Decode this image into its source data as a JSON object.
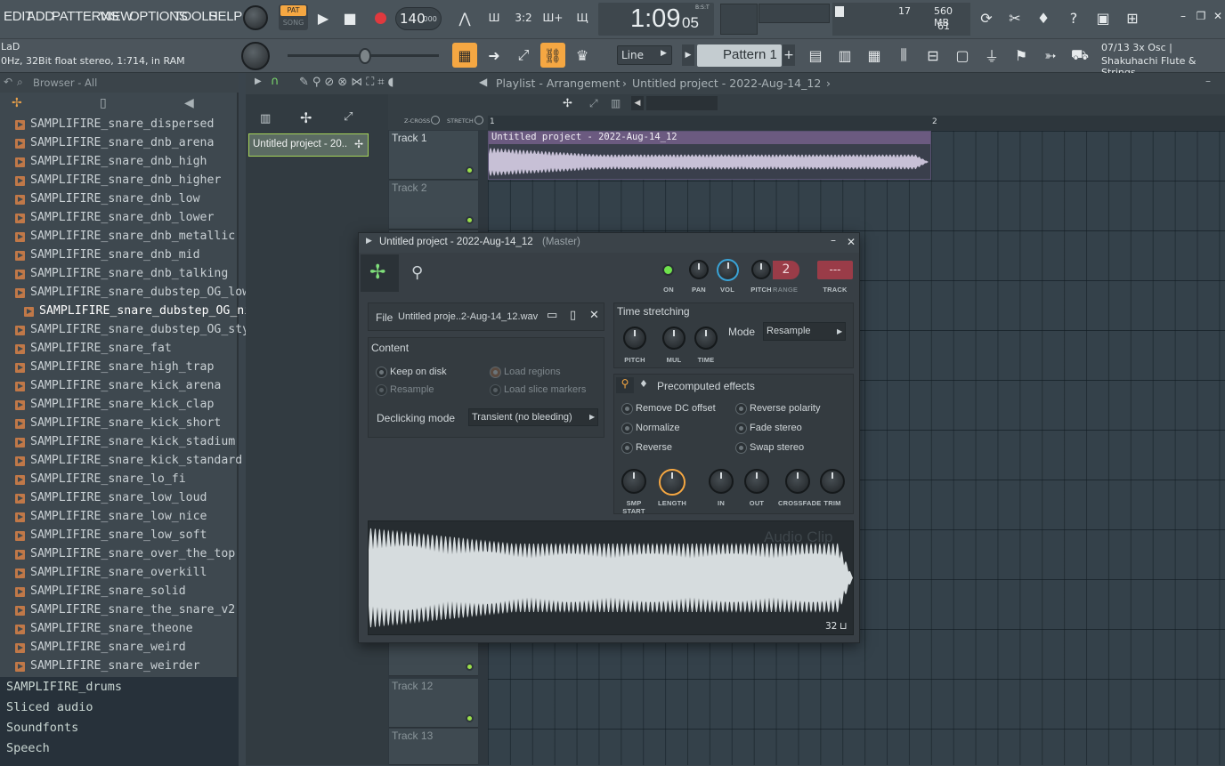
{
  "menu": [
    "EDIT",
    "ADD",
    "PATTERNS",
    "VIEW",
    "OPTIONS",
    "TOOLS",
    "HELP"
  ],
  "transport": {
    "pat": "PAT",
    "song": "SONG",
    "tempo": "140",
    "tempo_dec": ".000",
    "time_main": "1:09",
    "time_sub": "05",
    "time_label": "B:S:T"
  },
  "perf": {
    "cpu": "17",
    "ram": "560 MB",
    "voices": "61"
  },
  "hint": {
    "top": "07/13  3x Osc |",
    "bottom": "Shakuhachi Flute & Strings"
  },
  "status": {
    "line1": "LaD",
    "line2": "0Hz, 32Bit float stereo, 1:714, in RAM"
  },
  "snap": "Line",
  "pattern": "Pattern 1",
  "browser": {
    "title": "Browser - All",
    "items": [
      "SAMPLIFIRE_snare_dispersed",
      "SAMPLIFIRE_snare_dnb_arena",
      "SAMPLIFIRE_snare_dnb_high",
      "SAMPLIFIRE_snare_dnb_higher",
      "SAMPLIFIRE_snare_dnb_low",
      "SAMPLIFIRE_snare_dnb_lower",
      "SAMPLIFIRE_snare_dnb_metallic",
      "SAMPLIFIRE_snare_dnb_mid",
      "SAMPLIFIRE_snare_dnb_talking",
      "SAMPLIFIRE_snare_dubstep_OG_low",
      "SAMPLIFIRE_snare_dubstep_OG_nice",
      "SAMPLIFIRE_snare_dubstep_OG_style",
      "SAMPLIFIRE_snare_fat",
      "SAMPLIFIRE_snare_high_trap",
      "SAMPLIFIRE_snare_kick_arena",
      "SAMPLIFIRE_snare_kick_clap",
      "SAMPLIFIRE_snare_kick_short",
      "SAMPLIFIRE_snare_kick_stadium",
      "SAMPLIFIRE_snare_kick_standard",
      "SAMPLIFIRE_snare_lo_fi",
      "SAMPLIFIRE_snare_low_loud",
      "SAMPLIFIRE_snare_low_nice",
      "SAMPLIFIRE_snare_low_soft",
      "SAMPLIFIRE_snare_over_the_top",
      "SAMPLIFIRE_snare_overkill",
      "SAMPLIFIRE_snare_solid",
      "SAMPLIFIRE_snare_the_snare_v2",
      "SAMPLIFIRE_snare_theone",
      "SAMPLIFIRE_snare_weird",
      "SAMPLIFIRE_snare_weirder"
    ],
    "selected_index": 10,
    "folders": [
      "SAMPLIFIRE_drums",
      "Sliced audio",
      "Soundfonts",
      "Speech"
    ]
  },
  "playlist": {
    "title": "Playlist - Arrangement",
    "project": "Untitled project - 2022-Aug-14_12",
    "zcross": "Z-CROSS",
    "stretch": "STRETCH",
    "bar1": "1",
    "bar2": "2",
    "clip_label": "Untitled project - 2022-Aug-14_12",
    "picker_item": "Untitled project - 20..",
    "tracks": [
      "Track 1",
      "Track 2",
      "Track 12",
      "Track 13"
    ]
  },
  "dialog": {
    "title": "Untitled project - 2022-Aug-14_12",
    "title_suffix": "(Master)",
    "knob_labels": {
      "on": "ON",
      "pan": "PAN",
      "vol": "VOL",
      "pitch": "PITCH",
      "range": "RANGE",
      "track": "TRACK"
    },
    "range_value": "2",
    "track_value": "---",
    "file_label": "File",
    "file_name": "Untitled proje..2-Aug-14_12.wav",
    "content_label": "Content",
    "keep_on_disk": "Keep on disk",
    "resample": "Resample",
    "load_regions": "Load regions",
    "load_slice_markers": "Load slice markers",
    "declicking_label": "Declicking mode",
    "declicking_value": "Transient (no bleeding)",
    "ts_label": "Time stretching",
    "ts_knobs": [
      "PITCH",
      "MUL",
      "TIME"
    ],
    "mode_label": "Mode",
    "mode_value": "Resample",
    "pre_label": "Precomputed effects",
    "effects_left": [
      "Remove DC offset",
      "Normalize",
      "Reverse"
    ],
    "effects_right": [
      "Reverse polarity",
      "Fade stereo",
      "Swap stereo"
    ],
    "env_knobs": [
      "SMP START",
      "LENGTH",
      "IN",
      "OUT",
      "CROSSFADE",
      "TRIM"
    ],
    "wave_label": "Audio Clip",
    "wave_count": "32"
  }
}
